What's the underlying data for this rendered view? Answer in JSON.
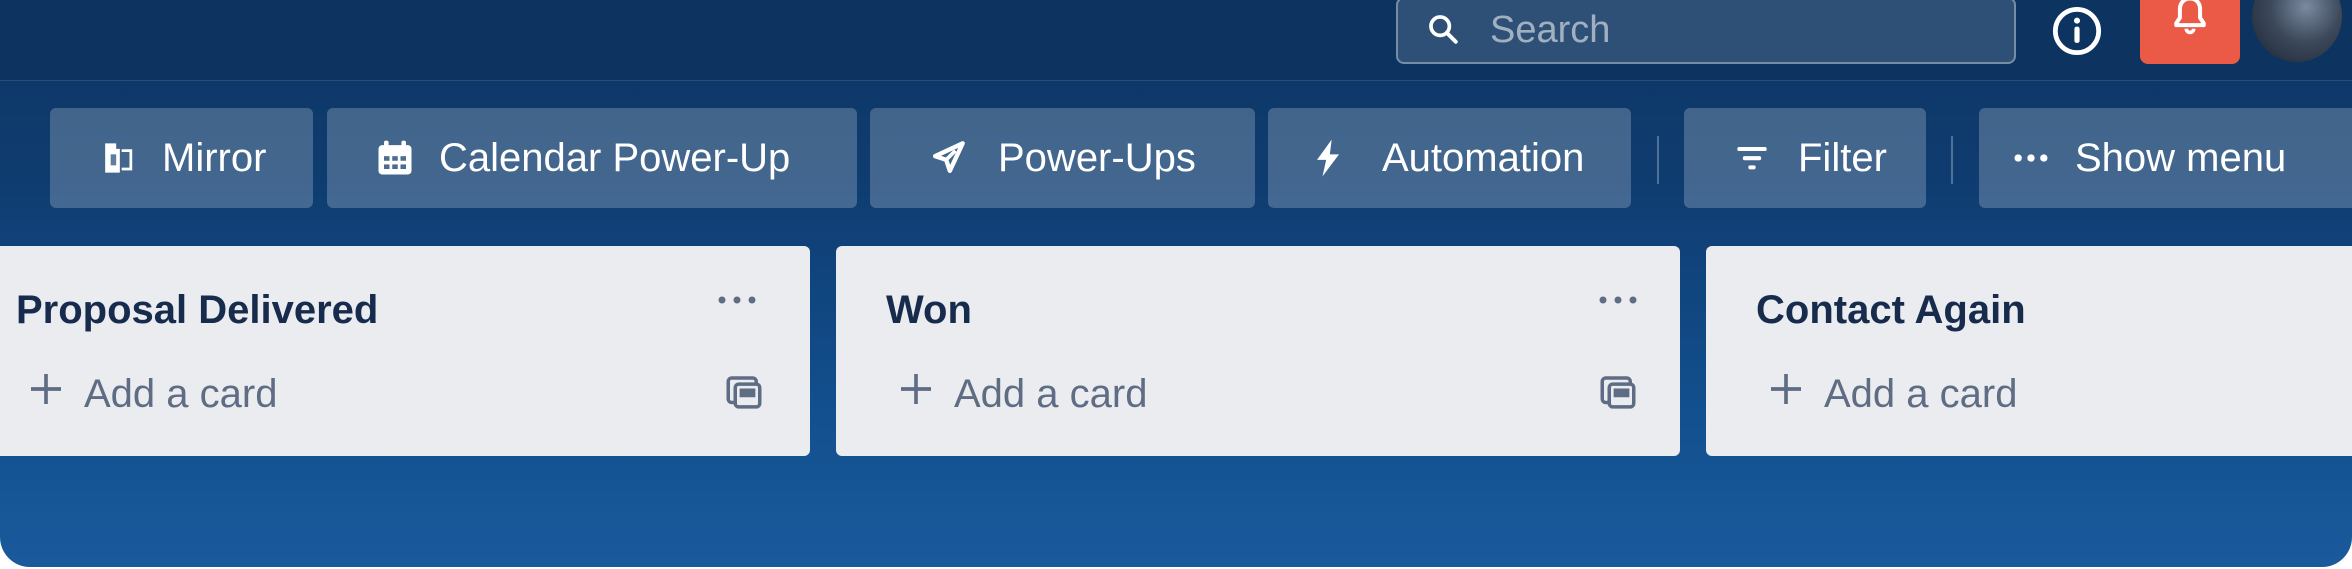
{
  "header": {
    "search_placeholder": "Search",
    "icons": [
      "search-icon",
      "info-icon",
      "bell-icon"
    ],
    "notification_color": "#eb5a46"
  },
  "toolbar": {
    "mirror": "Mirror",
    "calendar": "Calendar Power-Up",
    "powerups": "Power-Ups",
    "automation": "Automation",
    "filter": "Filter",
    "show_menu": "Show menu"
  },
  "lists": [
    {
      "title": "Proposal Delivered",
      "add_card": "Add a card"
    },
    {
      "title": "Won",
      "add_card": "Add a card"
    },
    {
      "title": "Contact Again",
      "add_card": "Add a card"
    }
  ],
  "colors": {
    "board_bg": "#0f3c70",
    "list_bg": "#ebecf0",
    "list_title": "#172b4d",
    "muted_text": "#5e6c84"
  }
}
